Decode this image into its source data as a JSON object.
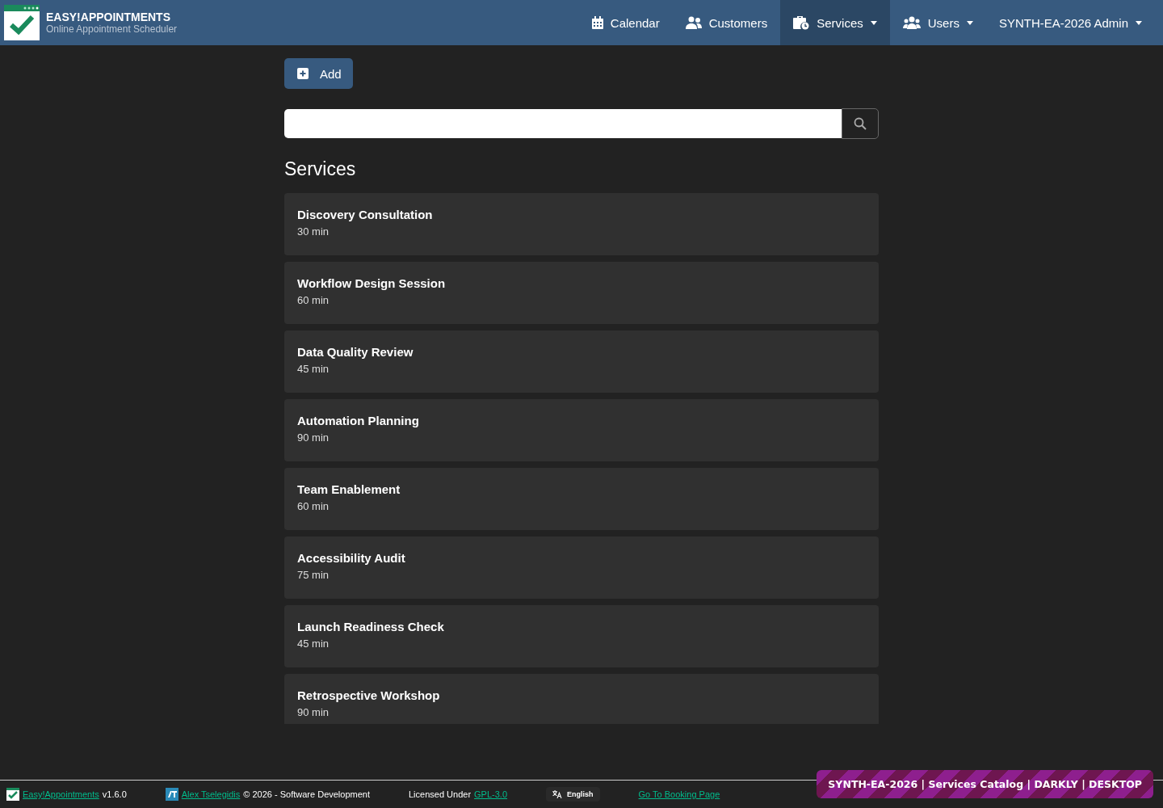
{
  "brand": {
    "title": "EASY!APPOINTMENTS",
    "subtitle": "Online Appointment Scheduler"
  },
  "nav": [
    {
      "label": "Calendar",
      "kind": "calendar",
      "dropdown": false,
      "selected": false
    },
    {
      "label": "Customers",
      "kind": "customers",
      "dropdown": false,
      "selected": false
    },
    {
      "label": "Services",
      "kind": "services",
      "dropdown": true,
      "selected": true
    },
    {
      "label": "Users",
      "kind": "users",
      "dropdown": true,
      "selected": false
    },
    {
      "label": "SYNTH-EA-2026 Admin",
      "kind": "account",
      "dropdown": true,
      "selected": false
    }
  ],
  "add_button": {
    "label": "Add"
  },
  "heading": "Services",
  "services": [
    {
      "name": "Discovery Consultation",
      "duration": "30 min"
    },
    {
      "name": "Workflow Design Session",
      "duration": "60 min"
    },
    {
      "name": "Data Quality Review",
      "duration": "45 min"
    },
    {
      "name": "Automation Planning",
      "duration": "90 min"
    },
    {
      "name": "Team Enablement",
      "duration": "60 min"
    },
    {
      "name": "Accessibility Audit",
      "duration": "75 min"
    },
    {
      "name": "Launch Readiness Check",
      "duration": "45 min"
    },
    {
      "name": "Retrospective Workshop",
      "duration": "90 min"
    }
  ],
  "footer": {
    "app_link": "Easy!Appointments",
    "version": "v1.6.0",
    "author_link": "Alex Tselegidis",
    "copyright": "© 2026 - Software Development",
    "license_text": "Licensed Under",
    "license_link": "GPL-3.0",
    "language": "English",
    "booking_link": "Go To Booking Page"
  },
  "badge": "SYNTH-EA-2026 | Services Catalog | DARKLY | DESKTOP"
}
